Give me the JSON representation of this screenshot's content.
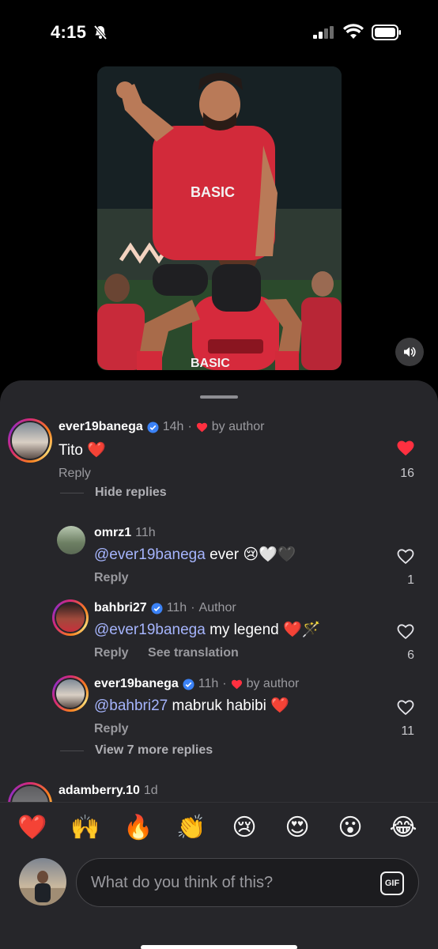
{
  "status": {
    "time": "4:15"
  },
  "comments": [
    {
      "username": "ever19banega",
      "time": "14h",
      "author_tag": "by author",
      "liked_by_author": true,
      "text": "Tito ❤️",
      "reply": "Reply",
      "likes": "16",
      "liked": true,
      "thread": "Hide replies"
    },
    {
      "username": "omrz1",
      "time": "11h",
      "mention": "@ever19banega",
      "text": " ever 😢🤍🖤",
      "reply": "Reply",
      "likes": "1"
    },
    {
      "username": "bahbri27",
      "time": "11h",
      "author_tag": "Author",
      "mention": "@ever19banega",
      "text": " my legend ❤️🪄",
      "reply": "Reply",
      "see_translation": "See translation",
      "likes": "6"
    },
    {
      "username": "ever19banega",
      "time": "11h",
      "author_tag": "by author",
      "liked_by_author": true,
      "mention": "@bahbri27",
      "text": " mabruk habibi ❤️",
      "reply": "Reply",
      "likes": "11",
      "thread": "View 7 more replies"
    },
    {
      "username": "adamberry.10",
      "time": "1d"
    }
  ],
  "emoji_bar": [
    "❤️",
    "🙌",
    "🔥",
    "👏",
    "😢",
    "😍",
    "😮",
    "😂"
  ],
  "composer": {
    "placeholder": "What do you think of this?",
    "gif_label": "GIF"
  },
  "colors": {
    "like_red": "#ff3040",
    "mention": "#a5b4fc",
    "verified": "#3b82f6"
  }
}
